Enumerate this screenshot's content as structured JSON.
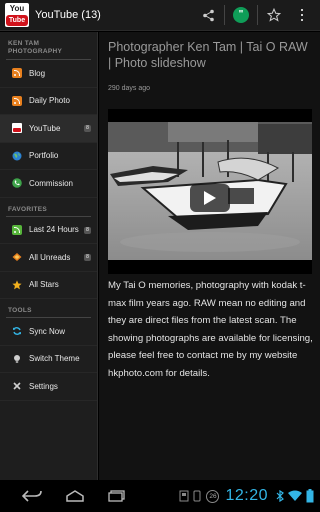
{
  "actionbar": {
    "app_name": "YouTube (13)",
    "logo_text_top": "You",
    "logo_text_bottom": "Tube"
  },
  "sidebar": {
    "section_feeds": "KEN TAM PHOTOGRAPHY",
    "feeds": [
      {
        "label": "Blog",
        "icon": "rss-icon"
      },
      {
        "label": "Daily Photo",
        "icon": "rss-icon"
      },
      {
        "label": "YouTube",
        "icon": "youtube-icon",
        "badge": "8"
      },
      {
        "label": "Portfolio",
        "icon": "globe-icon"
      },
      {
        "label": "Commission",
        "icon": "phone-icon"
      }
    ],
    "section_favorites": "FAVORITES",
    "favorites": [
      {
        "label": "Last 24 Hours",
        "icon": "rss-icon",
        "badge": "8"
      },
      {
        "label": "All Unreads",
        "icon": "stack-icon",
        "badge": "8"
      },
      {
        "label": "All Stars",
        "icon": "star-icon"
      }
    ],
    "section_tools": "TOOLS",
    "tools": [
      {
        "label": "Sync Now",
        "icon": "sync-icon"
      },
      {
        "label": "Switch Theme",
        "icon": "bulb-icon"
      },
      {
        "label": "Settings",
        "icon": "wrench-icon"
      }
    ]
  },
  "article": {
    "title": "Photographer Ken Tam | Tai O RAW | Photo slideshow",
    "date": "290 days ago",
    "body": "My Tai O memories, photography with kodak t-max film years ago. RAW mean no editing and they are direct files from the latest scan. The showing photographs are available for licensing, please feel free to contact me by my website hkphoto.com for details."
  },
  "statusbar": {
    "time": "12:20",
    "notification_count": "26"
  },
  "colors": {
    "accent": "#33b5e5",
    "rss": "#e8801e",
    "youtube": "#d0121b",
    "hangouts": "#0f9d58"
  }
}
